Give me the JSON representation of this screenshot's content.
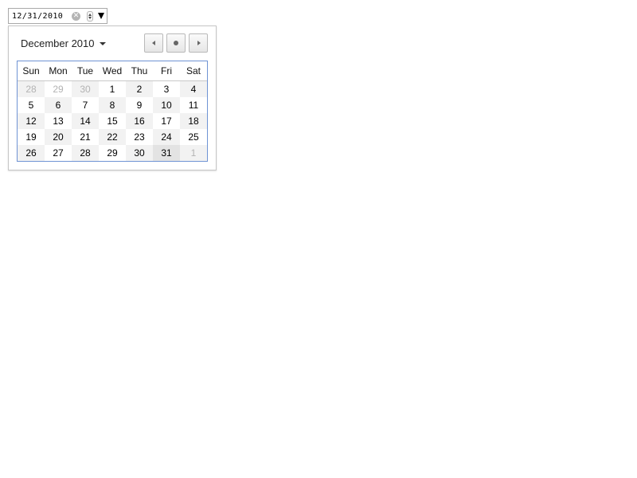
{
  "date_input": {
    "value": "12/31/2010",
    "clear_glyph": "✕"
  },
  "picker": {
    "month_label": "December 2010",
    "weekdays": [
      "Sun",
      "Mon",
      "Tue",
      "Wed",
      "Thu",
      "Fri",
      "Sat"
    ],
    "weeks": [
      [
        "28",
        "29",
        "30",
        "1",
        "2",
        "3",
        "4"
      ],
      [
        "5",
        "6",
        "7",
        "8",
        "9",
        "10",
        "11"
      ],
      [
        "12",
        "13",
        "14",
        "15",
        "16",
        "17",
        "18"
      ],
      [
        "19",
        "20",
        "21",
        "22",
        "23",
        "24",
        "25"
      ],
      [
        "26",
        "27",
        "28",
        "29",
        "30",
        "31",
        "1"
      ]
    ],
    "outside_month_days": [
      [
        0,
        0
      ],
      [
        0,
        1
      ],
      [
        0,
        2
      ],
      [
        4,
        6
      ]
    ],
    "selected_day": "31",
    "colors": {
      "grid_border": "#6f93d4",
      "muted_text": "#b3b3b3",
      "cell_shade": "#f2f2f2"
    }
  }
}
